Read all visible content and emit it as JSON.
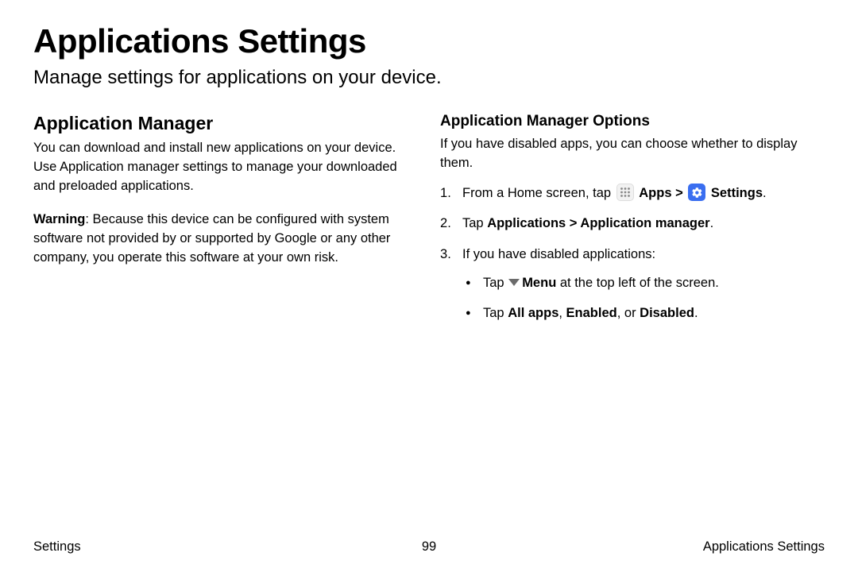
{
  "pageTitle": "Applications Settings",
  "pageSubtitle": "Manage settings for applications on your device.",
  "left": {
    "heading": "Application Manager",
    "para1": "You can download and install new applications on your device. Use Application manager settings to manage your downloaded and preloaded applications.",
    "warningLabel": "Warning",
    "warningText": ": Because this device can be configured with system software not provided by or supported by Google or any other company, you operate this software at your own risk."
  },
  "right": {
    "heading": "Application Manager Options",
    "intro": "If you have disabled apps, you can choose whether to display them.",
    "step1_a": "From a Home screen, tap ",
    "step1_apps": "Apps",
    "step1_sep": " > ",
    "step1_settings": "Settings",
    "step1_end": ".",
    "step2_a": "Tap ",
    "step2_b": "Applications",
    "step2_sep": " > ",
    "step2_c": "Application manager",
    "step2_end": ".",
    "step3": "If you have disabled applications:",
    "bullet1_a": "Tap ",
    "bullet1_menu": "Menu",
    "bullet1_b": "  at the top left of the screen.",
    "bullet2_a": "Tap ",
    "bullet2_b1": "All apps",
    "bullet2_c": ", ",
    "bullet2_b2": "Enabled",
    "bullet2_d": ", or ",
    "bullet2_b3": "Disabled",
    "bullet2_end": "."
  },
  "footer": {
    "left": "Settings",
    "center": "99",
    "right": "Applications Settings"
  }
}
